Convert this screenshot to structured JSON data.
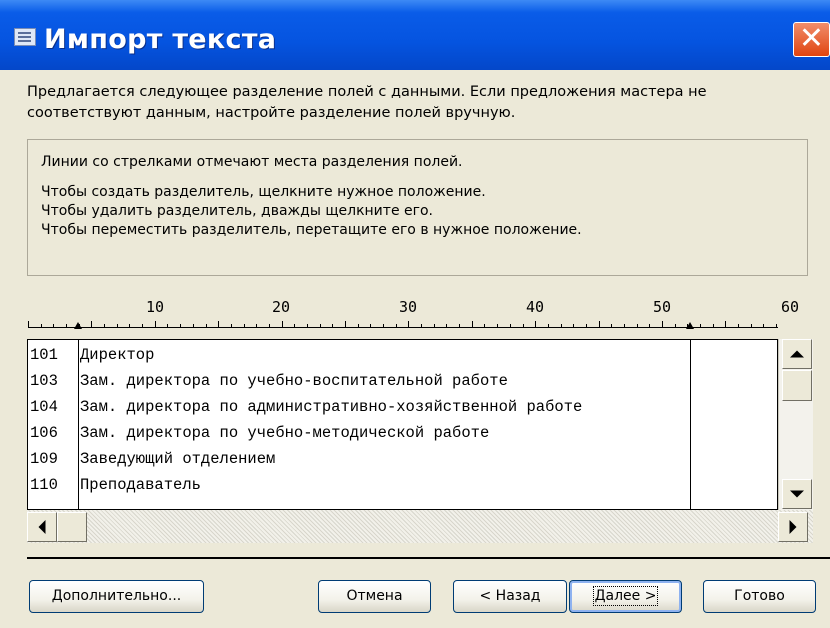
{
  "window": {
    "title": "Импорт текста",
    "icon": "window-app-icon",
    "close_icon": "close-icon",
    "close_glyph": "✕"
  },
  "intro": "Предлагается следующее разделение полей с данными. Если предложения мастера не соответствуют данным, настройте разделение полей вручную.",
  "instructions": {
    "line1": "Линии со стрелками отмечают места разделения полей.",
    "line2": "Чтобы создать разделитель, щелкните нужное положение.",
    "line3": "Чтобы удалить разделитель, дважды щелкните его.",
    "line4": "Чтобы переместить разделитель, перетащите его в нужное положение."
  },
  "ruler": {
    "labels": [
      "10",
      "20",
      "30",
      "40",
      "50",
      "60"
    ],
    "field_breaks": [
      4,
      53
    ]
  },
  "preview_rows": [
    {
      "id": "101",
      "text": "Директор"
    },
    {
      "id": "103",
      "text": "Зам. директора по учебно-воспитательной работе"
    },
    {
      "id": "104",
      "text": "Зам. директора по административно-хозяйственной работе"
    },
    {
      "id": "106",
      "text": "Зам. директора по учебно-методической работе"
    },
    {
      "id": "109",
      "text": "Заведующий отделением"
    },
    {
      "id": "110",
      "text": "Преподаватель"
    }
  ],
  "buttons": {
    "advanced": "Дополнительно...",
    "cancel": "Отмена",
    "back": "< Назад",
    "next": "Далее >",
    "finish": "Готово"
  },
  "colors": {
    "titlebar": "#0554e0",
    "close": "#e1440f",
    "dialog": "#ece9d8"
  }
}
